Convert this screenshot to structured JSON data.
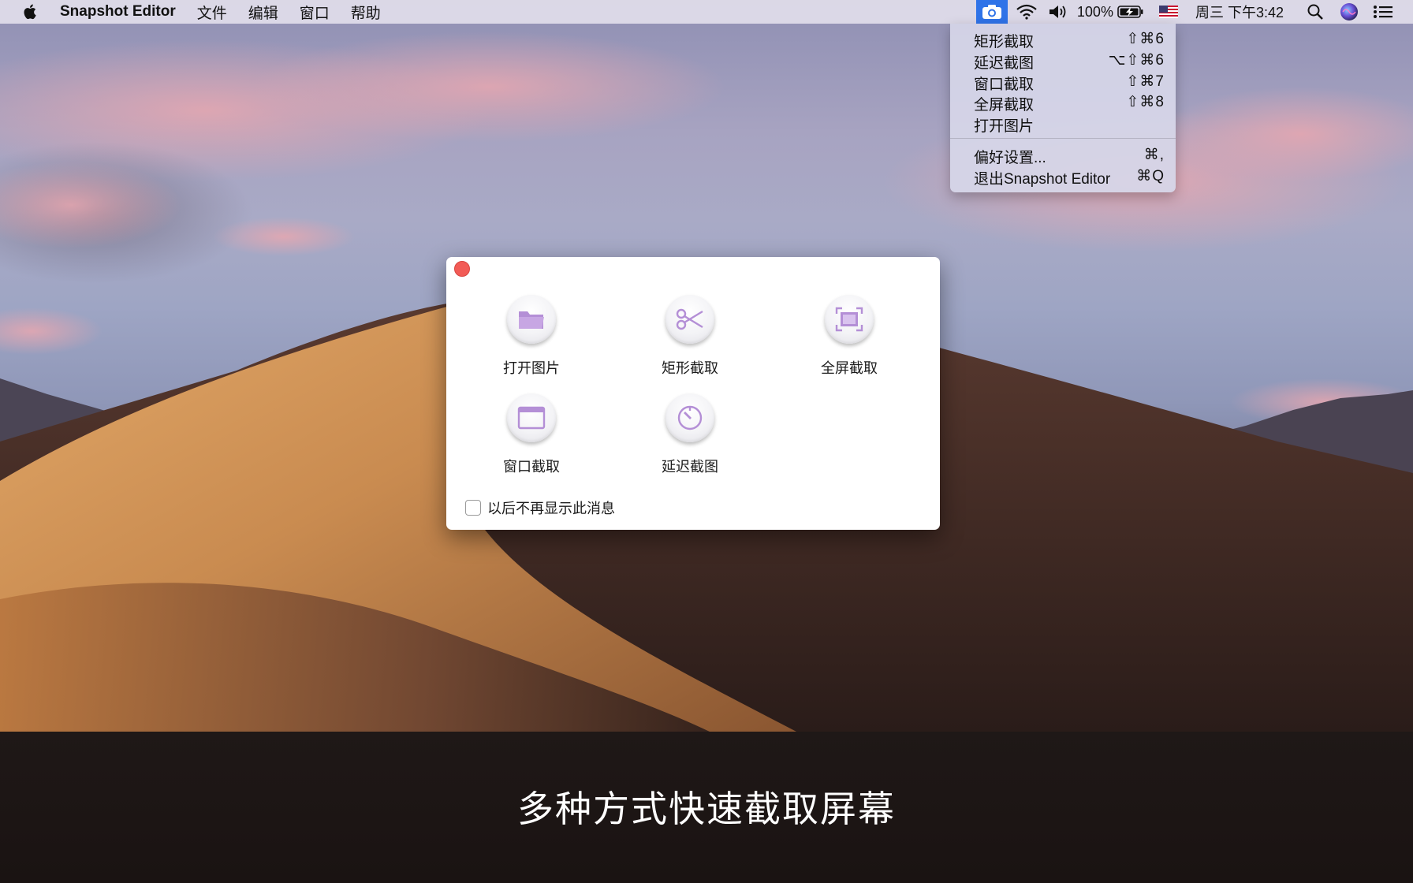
{
  "menubar": {
    "app_name": "Snapshot Editor",
    "menus": [
      "文件",
      "编辑",
      "窗口",
      "帮助"
    ],
    "battery": "100%",
    "clock": "周三 下午3:42",
    "icons": [
      "apple-icon",
      "camera-icon",
      "wifi-icon",
      "volume-icon",
      "battery-charging-icon",
      "us-flag-icon",
      "search-icon",
      "siri-icon",
      "notification-list-icon"
    ]
  },
  "dropdown": {
    "items": [
      {
        "label": "矩形截取",
        "shortcut": "⇧⌘6"
      },
      {
        "label": "延迟截图",
        "shortcut": "⌥⇧⌘6"
      },
      {
        "label": "窗口截取",
        "shortcut": "⇧⌘7"
      },
      {
        "label": "全屏截取",
        "shortcut": "⇧⌘8"
      },
      {
        "label": "打开图片",
        "shortcut": ""
      },
      {
        "label": "偏好设置...",
        "shortcut": "⌘,"
      },
      {
        "label": "退出Snapshot Editor",
        "shortcut": "⌘Q"
      }
    ]
  },
  "dialog": {
    "tiles": [
      {
        "label": "打开图片",
        "icon": "folder-icon"
      },
      {
        "label": "矩形截取",
        "icon": "scissors-icon"
      },
      {
        "label": "全屏截取",
        "icon": "fullscreen-icon"
      },
      {
        "label": "窗口截取",
        "icon": "window-icon"
      },
      {
        "label": "延迟截图",
        "icon": "timer-icon"
      }
    ],
    "checkbox_label": "以后不再显示此消息",
    "checkbox_checked": false
  },
  "caption": "多种方式快速截取屏幕",
  "colors": {
    "accent": "#2f73e8",
    "icon_purple": "#b48fd6",
    "close_red": "#f25b56"
  }
}
